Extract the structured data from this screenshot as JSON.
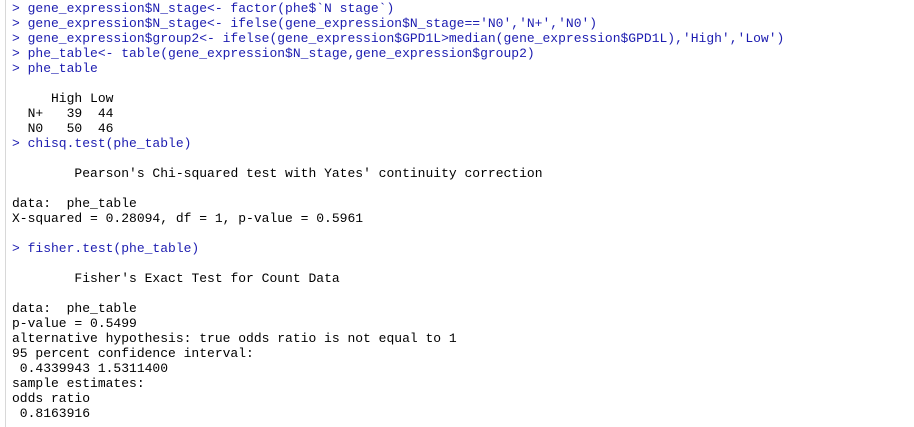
{
  "console": {
    "colors": {
      "input": "#1c1cb0",
      "output": "#000000"
    },
    "lines": [
      {
        "type": "input",
        "text": "> gene_expression$N_stage<- factor(phe$`N stage`)"
      },
      {
        "type": "input",
        "text": "> gene_expression$N_stage<- ifelse(gene_expression$N_stage=='N0','N+','N0')"
      },
      {
        "type": "input",
        "text": "> gene_expression$group2<- ifelse(gene_expression$GPD1L>median(gene_expression$GPD1L),'High','Low')"
      },
      {
        "type": "input",
        "text": "> phe_table<- table(gene_expression$N_stage,gene_expression$group2)"
      },
      {
        "type": "input",
        "text": "> phe_table"
      },
      {
        "type": "output",
        "text": ""
      },
      {
        "type": "output",
        "text": "     High Low"
      },
      {
        "type": "output",
        "text": "  N+   39  44"
      },
      {
        "type": "output",
        "text": "  N0   50  46"
      },
      {
        "type": "input",
        "text": "> chisq.test(phe_table)"
      },
      {
        "type": "output",
        "text": ""
      },
      {
        "type": "output",
        "text": "\tPearson's Chi-squared test with Yates' continuity correction"
      },
      {
        "type": "output",
        "text": ""
      },
      {
        "type": "output",
        "text": "data:  phe_table"
      },
      {
        "type": "output",
        "text": "X-squared = 0.28094, df = 1, p-value = 0.5961"
      },
      {
        "type": "output",
        "text": ""
      },
      {
        "type": "input",
        "text": "> fisher.test(phe_table)"
      },
      {
        "type": "output",
        "text": ""
      },
      {
        "type": "output",
        "text": "\tFisher's Exact Test for Count Data"
      },
      {
        "type": "output",
        "text": ""
      },
      {
        "type": "output",
        "text": "data:  phe_table"
      },
      {
        "type": "output",
        "text": "p-value = 0.5499"
      },
      {
        "type": "output",
        "text": "alternative hypothesis: true odds ratio is not equal to 1"
      },
      {
        "type": "output",
        "text": "95 percent confidence interval:"
      },
      {
        "type": "output",
        "text": " 0.4339943 1.5311400"
      },
      {
        "type": "output",
        "text": "sample estimates:"
      },
      {
        "type": "output",
        "text": "odds ratio "
      },
      {
        "type": "output",
        "text": " 0.8163916 "
      }
    ]
  }
}
